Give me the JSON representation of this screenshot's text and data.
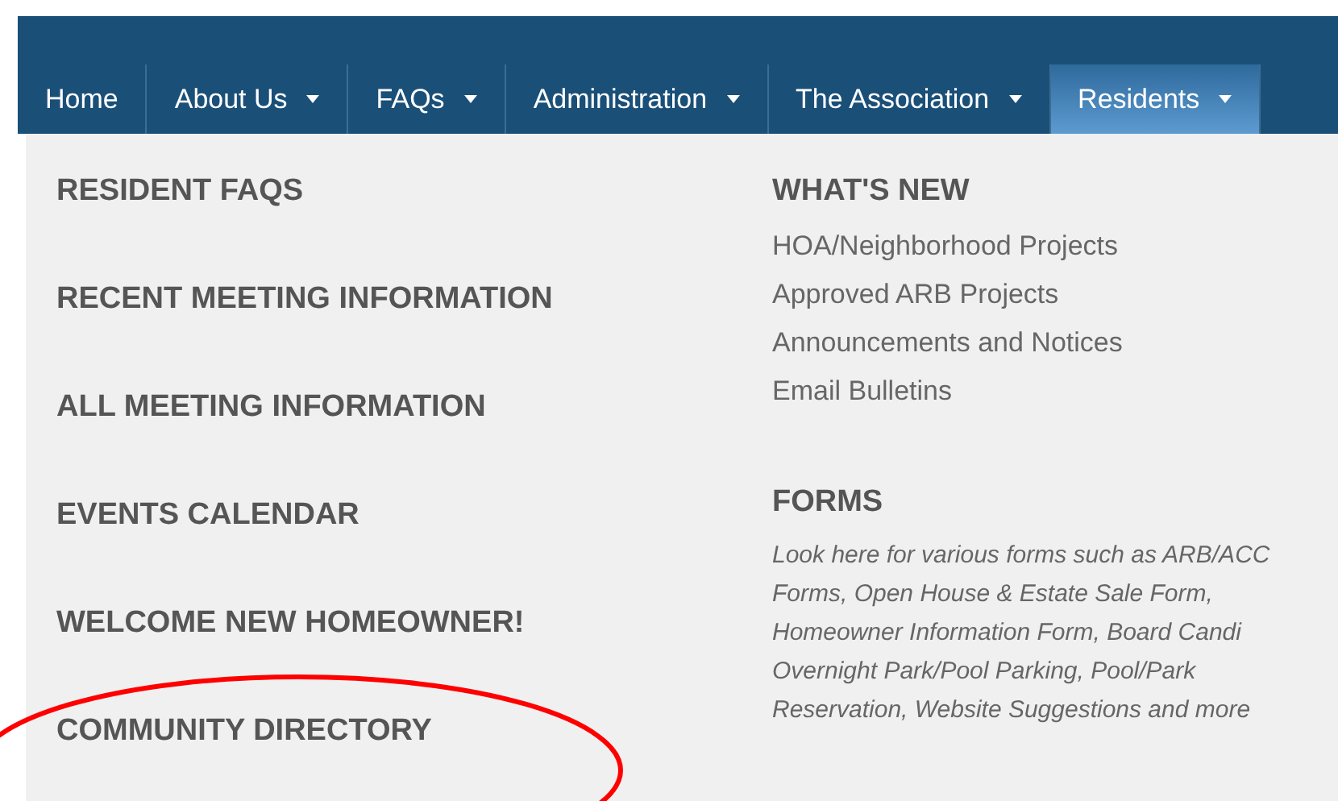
{
  "nav": [
    {
      "label": "Home",
      "dropdown": false,
      "selected": false
    },
    {
      "label": "About Us",
      "dropdown": true,
      "selected": false
    },
    {
      "label": "FAQs",
      "dropdown": true,
      "selected": false
    },
    {
      "label": "Administration",
      "dropdown": true,
      "selected": false
    },
    {
      "label": "The Association",
      "dropdown": true,
      "selected": false
    },
    {
      "label": "Residents",
      "dropdown": true,
      "selected": true
    }
  ],
  "menu": {
    "left_links": [
      "RESIDENT FAQS",
      "RECENT MEETING INFORMATION",
      "ALL MEETING INFORMATION",
      "EVENTS CALENDAR",
      "WELCOME NEW HOMEOWNER!",
      "COMMUNITY DIRECTORY"
    ],
    "whats_new": {
      "heading": "WHAT'S NEW",
      "links": [
        "HOA/Neighborhood Projects",
        "Approved ARB Projects",
        "Announcements and Notices",
        "Email Bulletins"
      ]
    },
    "forms": {
      "heading": "FORMS",
      "description_lines": [
        "Look here for various forms such as ARB/ACC",
        "Forms, Open House & Estate Sale Form,",
        "Homeowner Information Form, Board Candi",
        "Overnight Park/Pool Parking, Pool/Park",
        "Reservation, Website Suggestions and more"
      ]
    }
  },
  "annotation": {
    "kind": "ellipse",
    "color": "#ff0000"
  }
}
